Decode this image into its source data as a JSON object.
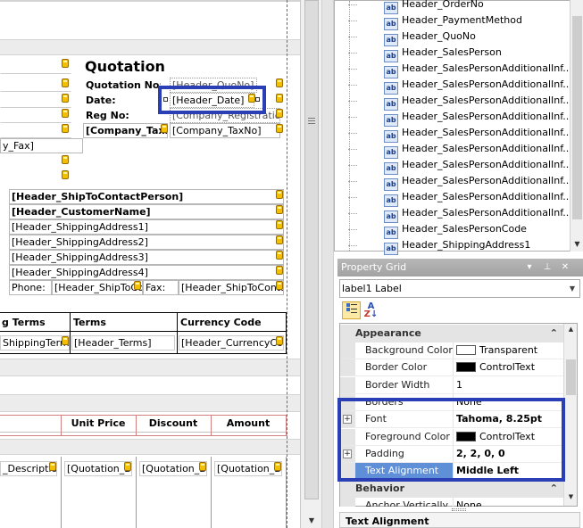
{
  "designer": {
    "title": "Quotation",
    "labels": {
      "quotation_no": "Quotation No:",
      "date": "Date:",
      "reg_no": "Reg No:",
      "company_tax": "[Company_TaxNo"
    },
    "values": {
      "quo_no": "[Header_QuoNo]",
      "date": "[Header_Date]",
      "reg_no": "[Company_Registration",
      "tax_no": "[Company_TaxNo]",
      "fax": "y_Fax]"
    },
    "ship_to": {
      "contact": "[Header_ShipToContactPerson]",
      "customer": "[Header_CustomerName]",
      "addr1": "[Header_ShippingAddress1]",
      "addr2": "[Header_ShippingAddress2]",
      "addr3": "[Header_ShippingAddress3]",
      "addr4": "[Header_ShippingAddress4]",
      "phone_label": "Phone:",
      "phone_value": "[Header_ShipToCo",
      "fax_label": "Fax:",
      "fax_value": "[Header_ShipToConta"
    },
    "terms_table": {
      "headers": [
        "g Terms",
        "Terms",
        "Currency Code"
      ],
      "values": [
        "ShippingTerms]",
        "[Header_Terms]",
        "[Header_CurrencyCode"
      ]
    },
    "detail_table": {
      "headers": [
        "Unit Price",
        "Discount",
        "Amount"
      ],
      "values": [
        "_Description",
        "[Quotation_D",
        "[Quotation_D",
        "[Quotation_D"
      ]
    }
  },
  "tree": {
    "items": [
      "Header_OrderNo",
      "Header_PaymentMethod",
      "Header_QuoNo",
      "Header_SalesPerson",
      "Header_SalesPersonAdditionalInf...",
      "Header_SalesPersonAdditionalInf...",
      "Header_SalesPersonAdditionalInf...",
      "Header_SalesPersonAdditionalInf...",
      "Header_SalesPersonAdditionalInf...",
      "Header_SalesPersonAdditionalInf...",
      "Header_SalesPersonAdditionalInf...",
      "Header_SalesPersonAdditionalInf...",
      "Header_SalesPersonAdditionalInf...",
      "Header_SalesPersonAdditionalInf...",
      "Header_SalesPersonCode",
      "Header_ShippingAddress1"
    ],
    "icon_text": "ab"
  },
  "property_grid": {
    "title": "Property Grid",
    "title_buttons": [
      "▭",
      "✕",
      "📌",
      "✕"
    ],
    "selected_object": "label1  Label",
    "categories": {
      "appearance": "Appearance",
      "behavior": "Behavior"
    },
    "rows": [
      {
        "name": "Background Color",
        "value": "Transparent",
        "swatch": "#ffffff"
      },
      {
        "name": "Border Color",
        "value": "ControlText",
        "swatch": "#000000"
      },
      {
        "name": "Border Width",
        "value": "1"
      },
      {
        "name": "Borders",
        "value": "None"
      },
      {
        "name": "Font",
        "value": "Tahoma, 8.25pt",
        "bold": true,
        "expandable": true
      },
      {
        "name": "Foreground Color",
        "value": "ControlText",
        "swatch": "#000000"
      },
      {
        "name": "Padding",
        "value": "2, 2, 0, 0",
        "bold": true,
        "expandable": true
      },
      {
        "name": "Text Alignment",
        "value": "Middle Left",
        "bold": true,
        "selected": true
      }
    ],
    "behavior_first_row": {
      "name": "Anchor Vertically",
      "value": "None"
    },
    "description_title": "Text Alignment"
  },
  "colors": {
    "highlight_box": "#2a3fb5",
    "selected_row": "#5f8fd6",
    "tag_yellow": "#f2c000",
    "margin_line": "#d83a3a"
  }
}
